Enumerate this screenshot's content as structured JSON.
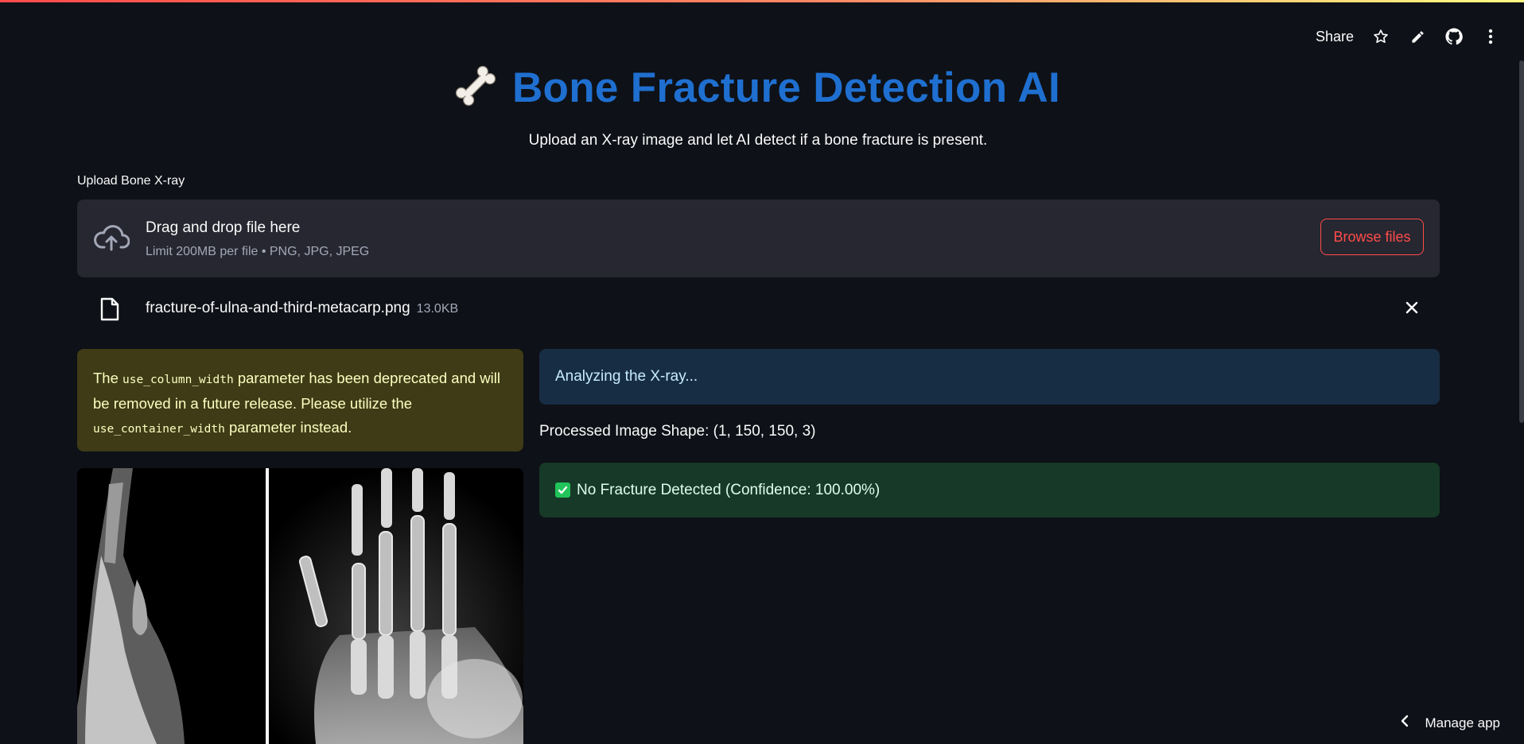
{
  "header": {
    "share_label": "Share",
    "icons": [
      "star-icon",
      "pencil-icon",
      "github-icon",
      "more-vertical-icon"
    ]
  },
  "title": {
    "icon": "bone-icon",
    "text": "Bone Fracture Detection AI",
    "color": "#1f6fd0"
  },
  "subtitle": "Upload an X-ray image and let AI detect if a bone fracture is present.",
  "uploader": {
    "label": "Upload Bone X-ray",
    "drop_text": "Drag and drop file here",
    "limit_text": "Limit 200MB per file • PNG, JPG, JPEG",
    "browse_label": "Browse files",
    "accent": "#ff4b4b"
  },
  "file": {
    "name": "fracture-of-ulna-and-third-metacarp.png",
    "size": "13.0KB"
  },
  "warning": {
    "pre": "The ",
    "code1": "use_column_width",
    "mid": " parameter has been deprecated and will be removed in a future release. Please utilize the ",
    "code2": "use_container_width",
    "post": " parameter instead."
  },
  "status": {
    "info": "Analyzing the X-ray...",
    "shape": "Processed Image Shape: (1, 150, 150, 3)",
    "result": "No Fracture Detected (Confidence: 100.00%)"
  },
  "footer": {
    "manage_label": "Manage app"
  }
}
